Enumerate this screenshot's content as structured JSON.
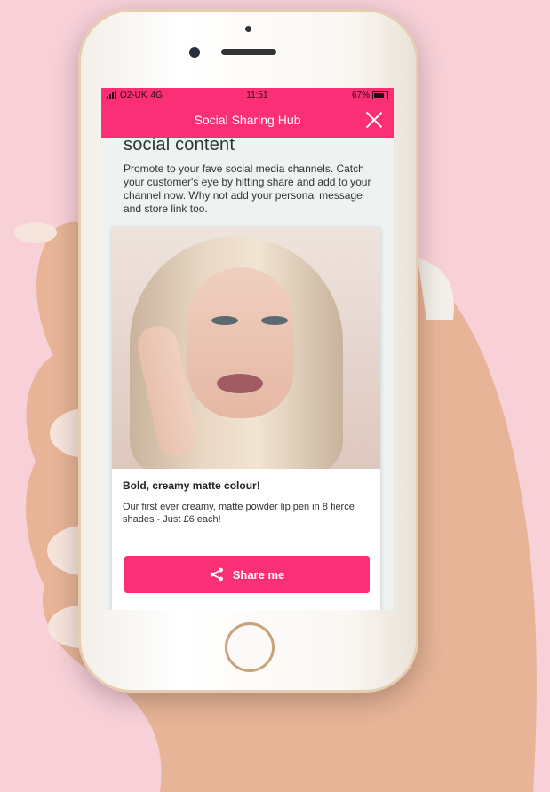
{
  "status_bar": {
    "carrier": "O2-UK",
    "network": "4G",
    "time": "11:51",
    "battery": "67%"
  },
  "header": {
    "title": "Social Sharing Hub",
    "close_icon": "close-icon"
  },
  "main": {
    "heading": "social content",
    "intro": "Promote to your fave social media channels. Catch your customer's eye by hitting share and add to your channel now. Why not add your personal message and store link too."
  },
  "card": {
    "title": "Bold, creamy matte colour!",
    "description": "Our first ever creamy, matte powder lip pen  in 8 fierce shades - Just £6 each!",
    "share_label": "Share me",
    "share_icon": "share-icon"
  },
  "colors": {
    "accent": "#fb2f75",
    "background": "#f8d0d8"
  }
}
